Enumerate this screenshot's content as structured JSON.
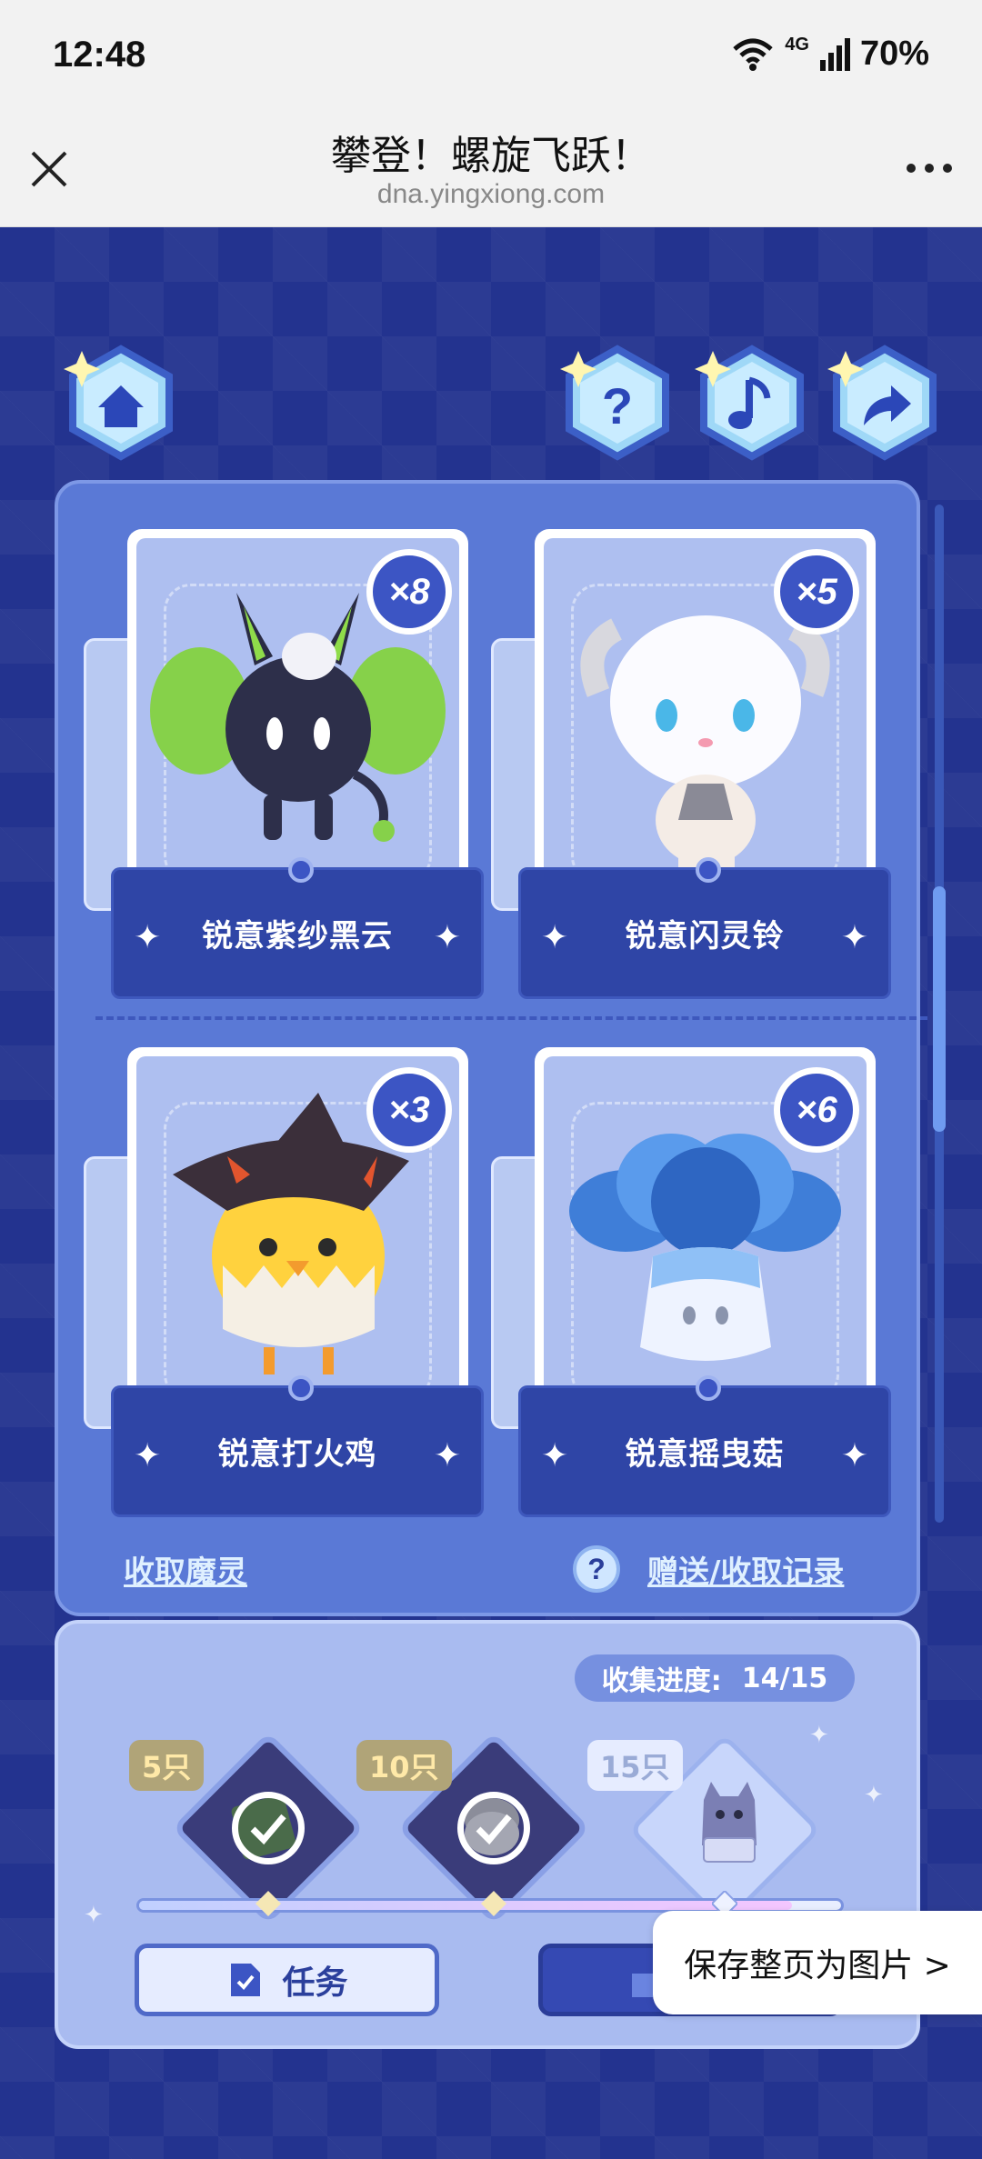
{
  "status_bar": {
    "time": "12:48",
    "network": "4G",
    "battery": "70%"
  },
  "titlebar": {
    "title": "攀登！螺旋飞跃！",
    "url": "dna.yingxiong.com"
  },
  "top_buttons": [
    "home-icon",
    "help-icon",
    "music-icon",
    "share-icon"
  ],
  "cards": [
    {
      "name": "锐意紫纱黑云",
      "count": "×8"
    },
    {
      "name": "锐意闪灵铃",
      "count": "×5"
    },
    {
      "name": "锐意打火鸡",
      "count": "×3"
    },
    {
      "name": "锐意摇曳菇",
      "count": "×6"
    }
  ],
  "links": {
    "receive": "收取魔灵",
    "history": "赠送/收取记录"
  },
  "progress": {
    "label": "收集进度:",
    "value": "14/15",
    "fraction": 0.93
  },
  "milestones": [
    {
      "label": "5只",
      "done": true
    },
    {
      "label": "10只",
      "done": true
    },
    {
      "label": "15只",
      "done": false
    }
  ],
  "buttons": {
    "task": "任务"
  },
  "toast": {
    "save_page": "保存整页为图片 >"
  },
  "colors": {
    "accent": "#3c55c4",
    "panel": "#5a79d6",
    "background": "#23338f"
  }
}
